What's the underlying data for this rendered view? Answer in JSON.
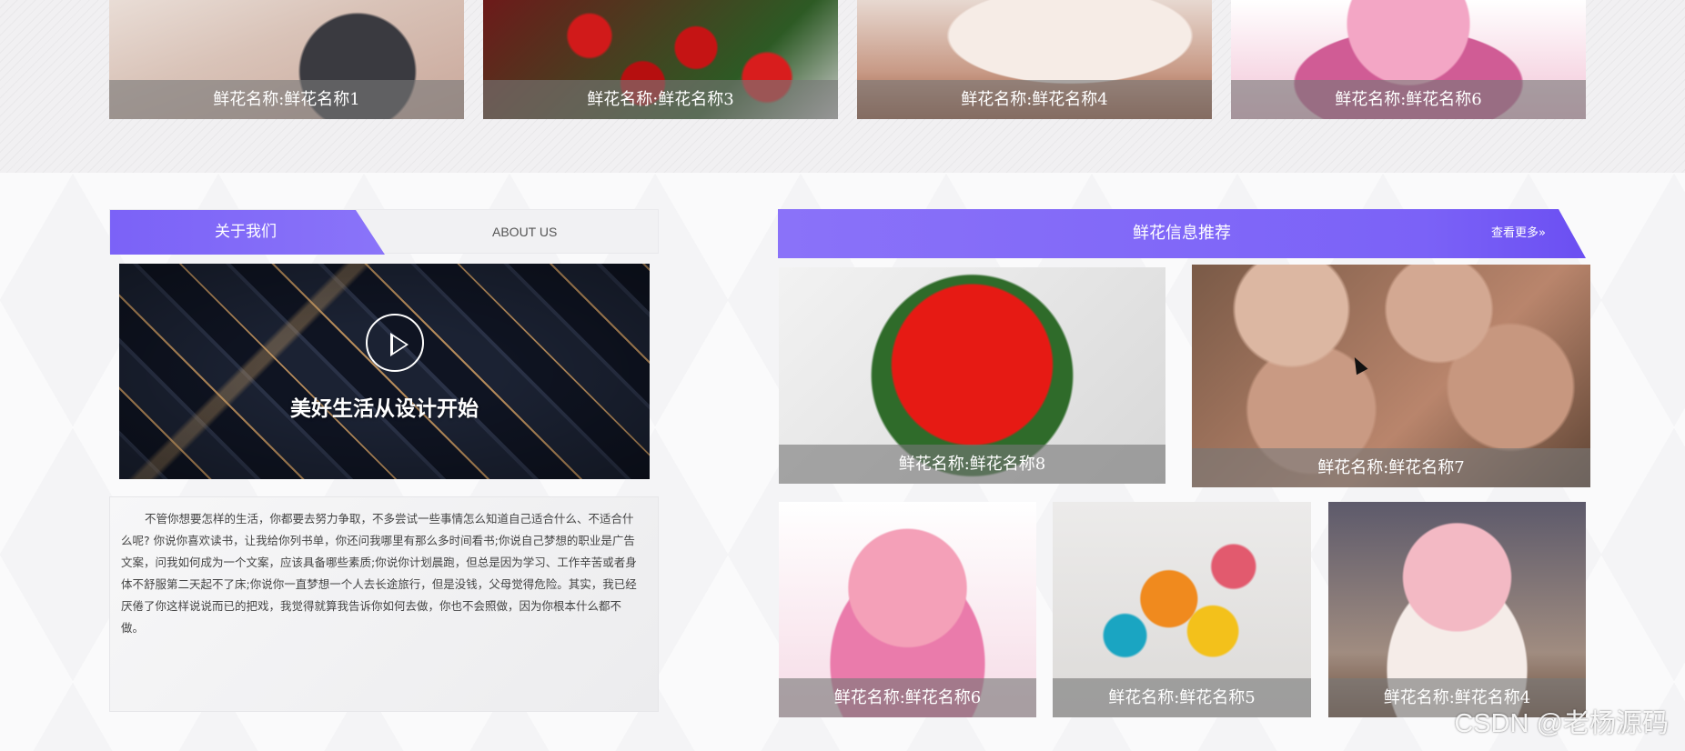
{
  "top_gallery": [
    {
      "caption": "鲜花名称:鲜花名称1",
      "icon": "bouquet-photo"
    },
    {
      "caption": "鲜花名称:鲜花名称3",
      "icon": "red-roses-photo"
    },
    {
      "caption": "鲜花名称:鲜花名称4",
      "icon": "flower-box-photo"
    },
    {
      "caption": "鲜花名称:鲜花名称6",
      "icon": "pink-bouquet-photo"
    }
  ],
  "about": {
    "tab_label": "关于我们",
    "english_label": "ABOUT US",
    "video_title": "美好生活从设计开始",
    "body": "不管你想要怎样的生活，你都要去努力争取，不多尝试一些事情怎么知道自己适合什么、不适合什么呢? 你说你喜欢读书，让我给你列书单，你还问我哪里有那么多时间看书;你说自己梦想的职业是广告文案，问我如何成为一个文案，应该具备哪些素质;你说你计划晨跑，但总是因为学习、工作辛苦或者身体不舒服第二天起不了床;你说你一直梦想一个人去长途旅行，但是没钱，父母觉得危险。其实，我已经厌倦了你这样说说而已的把戏，我觉得就算我告诉你如何去做，你也不会照做，因为你根本什么都不做。"
  },
  "recommend": {
    "title": "鲜花信息推荐",
    "more_label": "查看更多»",
    "items_row1": [
      {
        "caption": "鲜花名称:鲜花名称8",
        "icon": "red-roses-photo"
      },
      {
        "caption": "鲜花名称:鲜花名称7",
        "icon": "champagne-roses-photo"
      }
    ],
    "items_row2": [
      {
        "caption": "鲜花名称:鲜花名称6",
        "icon": "pink-bouquet-photo"
      },
      {
        "caption": "鲜花名称:鲜花名称5",
        "icon": "paper-flowers-photo"
      },
      {
        "caption": "鲜花名称:鲜花名称4",
        "icon": "flower-box-photo"
      }
    ]
  },
  "watermark": "CSDN @老杨源码",
  "colors": {
    "accent": "#7b62f7",
    "caption_bg": "#787878"
  }
}
